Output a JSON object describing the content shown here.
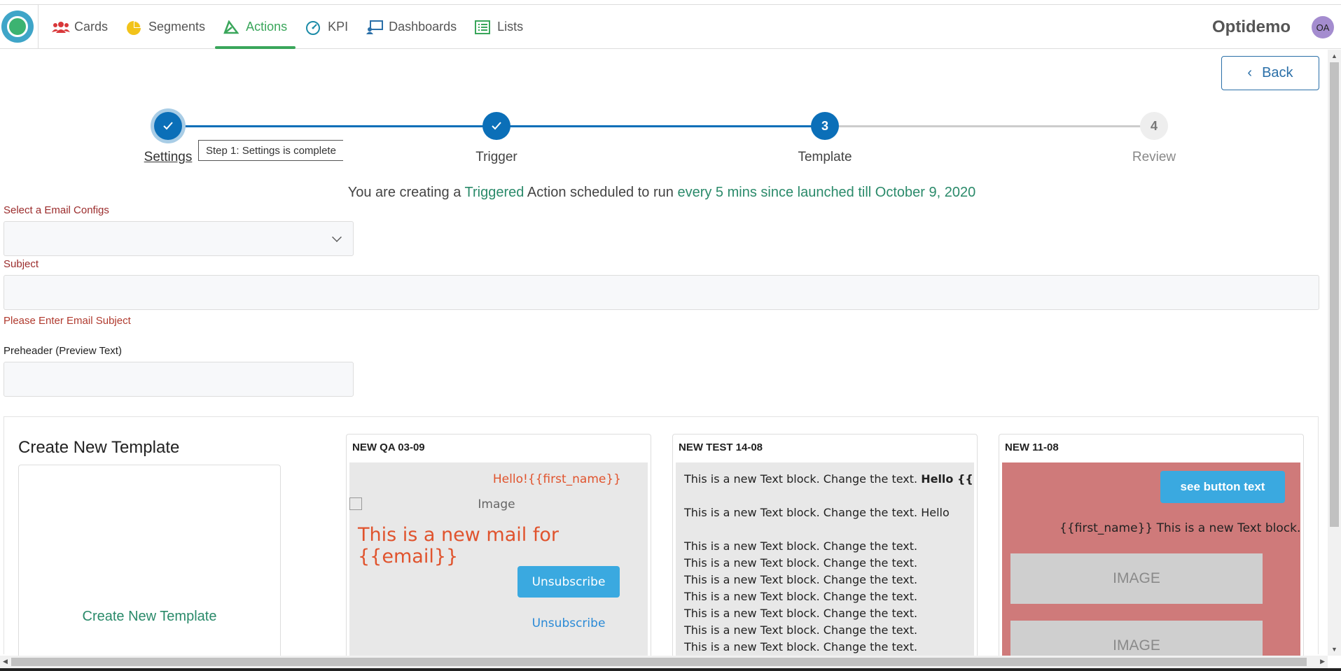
{
  "brand": "Optidemo",
  "avatar": "OA",
  "nav": [
    {
      "label": "Cards",
      "icon": "users-icon"
    },
    {
      "label": "Segments",
      "icon": "pie-chart-icon"
    },
    {
      "label": "Actions",
      "icon": "actions-icon",
      "active": true
    },
    {
      "label": "KPI",
      "icon": "gauge-icon"
    },
    {
      "label": "Dashboards",
      "icon": "dashboard-icon"
    },
    {
      "label": "Lists",
      "icon": "list-icon"
    }
  ],
  "back_label": "Back",
  "steps": [
    {
      "label": "Settings",
      "state": "done"
    },
    {
      "label": "Trigger",
      "state": "done"
    },
    {
      "label": "Template",
      "state": "current",
      "number": "3"
    },
    {
      "label": "Review",
      "state": "pending",
      "number": "4"
    }
  ],
  "tooltip": "Step 1: Settings is complete",
  "summary": {
    "p1": "You are creating a ",
    "type": "Triggered",
    "p2": " Action scheduled to run ",
    "schedule": "every 5 mins since launched till October 9, 2020"
  },
  "form": {
    "email_config_label": "Select a Email Configs",
    "subject_label": "Subject",
    "subject_error": "Please Enter Email Subject",
    "preheader_label": "Preheader (Preview Text)"
  },
  "create": {
    "title": "Create New Template",
    "link": "Create New Template"
  },
  "templates": [
    {
      "name": "NEW QA 03-09",
      "hello": "Hello!{{first_name}}",
      "image_alt": "Image",
      "headline": "This is a new mail for {{email}}",
      "button": "Unsubscribe",
      "link": "Unsubscribe"
    },
    {
      "name": "NEW TEST 14-08",
      "line1": "This is a new Text block. Change the text. ",
      "line1_bold": "Hello {{User",
      "line2": "This is a new Text block. Change the text. Hello",
      "repeat": "This is a new Text block. Change the text."
    },
    {
      "name": "NEW 11-08",
      "button": "see button text",
      "text": "{{first_name}} This is a new Text block. Change the text.",
      "image1": "IMAGE",
      "image2": "IMAGE"
    }
  ],
  "colors": {
    "accent": "#3aa65b",
    "primary": "#0b6fb8",
    "link": "#2a8a6a",
    "error": "#b03a2e"
  }
}
